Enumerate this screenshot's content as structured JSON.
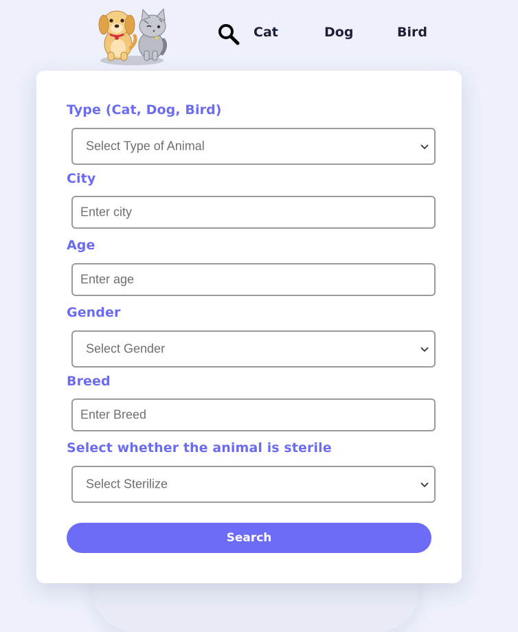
{
  "header": {
    "logo_name": "dog-and-cat-logo",
    "search_icon": "search-icon",
    "nav": [
      {
        "label": "Cat"
      },
      {
        "label": "Dog"
      },
      {
        "label": "Bird"
      }
    ]
  },
  "form": {
    "type": {
      "label": "Type (Cat, Dog, Bird)",
      "selected": "Select Type of Animal"
    },
    "city": {
      "label": "City",
      "placeholder": "Enter city"
    },
    "age": {
      "label": "Age",
      "placeholder": "Enter age"
    },
    "gender": {
      "label": "Gender",
      "selected": "Select Gender"
    },
    "breed": {
      "label": "Breed",
      "placeholder": "Enter Breed"
    },
    "sterile": {
      "label": "Select whether the animal is sterile",
      "selected": "Select Sterilize"
    },
    "submit_label": "Search"
  },
  "colors": {
    "accent": "#6c6cf0",
    "button": "#6c6cf6",
    "background": "#eef1fb",
    "nav_text": "#1f1f3a"
  }
}
